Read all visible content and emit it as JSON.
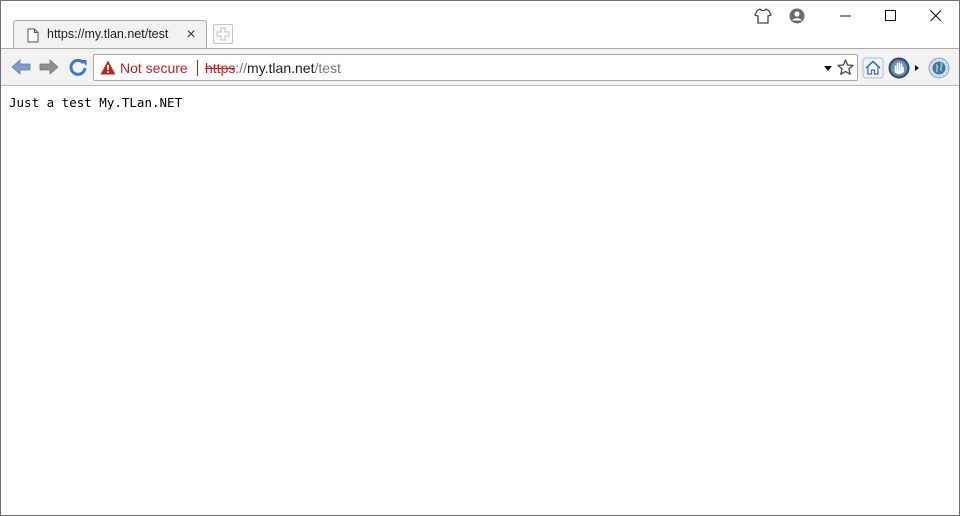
{
  "tab": {
    "title": "https://my.tlan.net/test",
    "close": "×"
  },
  "omnibox": {
    "security_label": "Not secure",
    "url_scheme": "https",
    "url_separator": "://",
    "url_host": "my.tlan.net",
    "url_path": "/test"
  },
  "page": {
    "body_text": "Just a test My.TLan.NET"
  },
  "colors": {
    "insecure_red": "#c5221f",
    "toolbar_bg": "#f2f2f2",
    "nav_arrow_blue": "#7a9cc6",
    "reload_blue": "#3a78c8"
  },
  "icons": {
    "tab_favicon": "page-icon",
    "new_tab": "plus-icon",
    "titlebar": [
      "shirt-icon",
      "profile-icon"
    ],
    "window_controls": [
      "minimize-icon",
      "maximize-icon",
      "close-icon"
    ],
    "nav": [
      "back-arrow-icon",
      "forward-arrow-icon",
      "reload-icon"
    ],
    "omnibox": [
      "warning-triangle-icon",
      "dropdown-arrow-icon",
      "star-icon"
    ],
    "extensions": [
      "home-icon",
      "hand-icon",
      "chevron-right-icon",
      "globe-icon"
    ]
  }
}
